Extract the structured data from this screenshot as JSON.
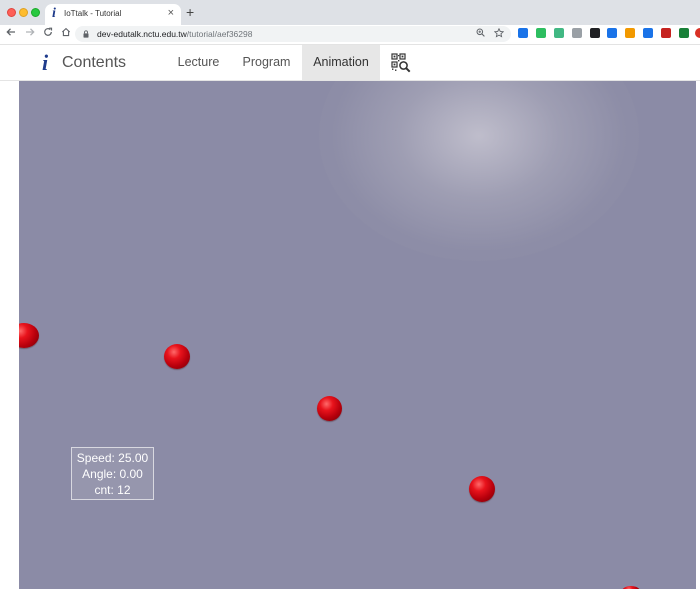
{
  "browser": {
    "tab": {
      "favicon": "i",
      "title": "IoTtalk - Tutorial",
      "close_glyph": "×"
    },
    "new_tab_glyph": "+",
    "url_host": "dev-edutalk.nctu.edu.tw",
    "url_path": "/tutorial/aef36298",
    "nav_icons": [
      "back-arrow-icon",
      "forward-arrow-icon",
      "reload-icon",
      "home-icon"
    ],
    "extensions": [
      {
        "name": "ext-person-icon",
        "color": "#1a73e8"
      },
      {
        "name": "ext-evernote-icon",
        "color": "#2dbe60"
      },
      {
        "name": "ext-vue-icon",
        "color": "#41b883"
      },
      {
        "name": "ext-shield-icon",
        "color": "#9aa0a6"
      },
      {
        "name": "ext-dark-icon",
        "color": "#202124"
      },
      {
        "name": "ext-sync-icon",
        "color": "#1a73e8"
      },
      {
        "name": "ext-orange-icon",
        "color": "#f29900"
      },
      {
        "name": "ext-plus-icon",
        "color": "#1a73e8"
      },
      {
        "name": "ext-cross-icon",
        "color": "#c5221f"
      },
      {
        "name": "ext-check-icon",
        "color": "#188038"
      },
      {
        "name": "ext-red-icon",
        "color": "#d93025"
      }
    ]
  },
  "navbar": {
    "brand_icon": "i",
    "brand_label": "Contents",
    "links": [
      {
        "label": "Lecture",
        "active": false
      },
      {
        "label": "Program",
        "active": false
      },
      {
        "label": "Animation",
        "active": true
      }
    ],
    "qr_icon": "qr-search-icon"
  },
  "animation": {
    "background": "#8b8ba6",
    "ball_color": "#d9101a",
    "hud": {
      "speed": "Speed: 25.00",
      "angle": "Angle: 0.00",
      "cnt": "cnt: 12"
    }
  }
}
